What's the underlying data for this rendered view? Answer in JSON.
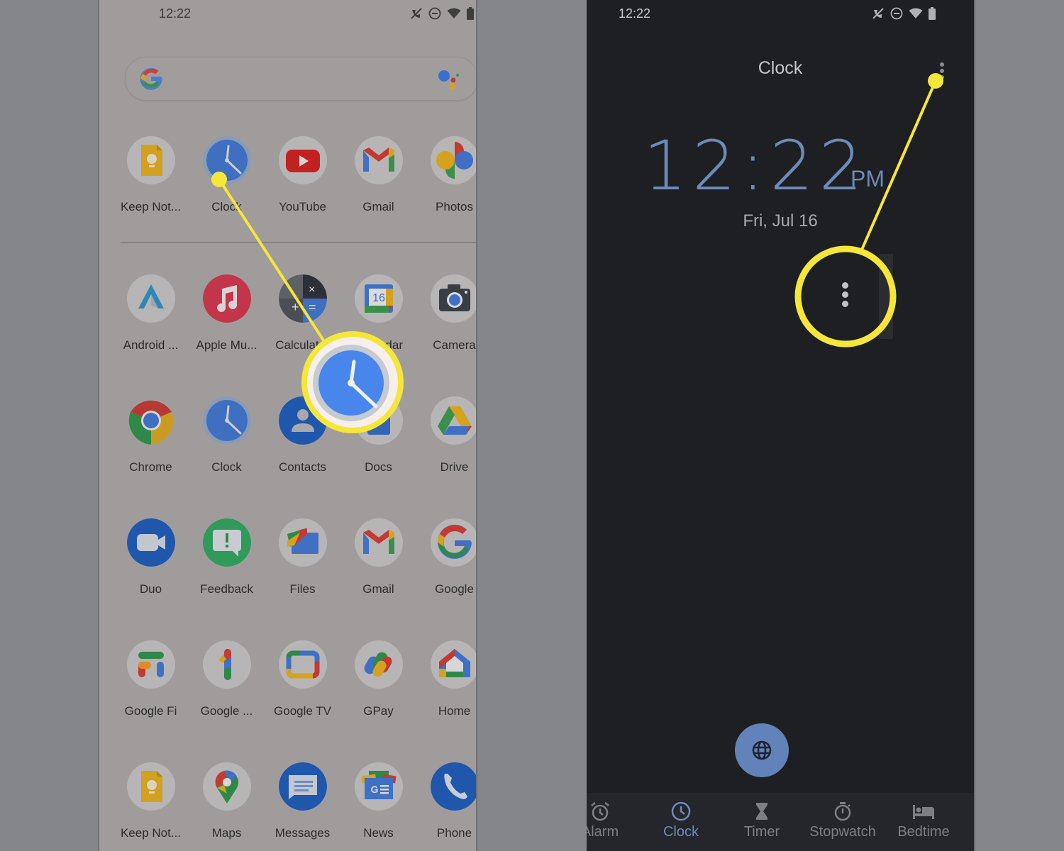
{
  "left_phone": {
    "status_bar": {
      "time": "12:22",
      "icons": [
        "call-muted-icon",
        "do-not-disturb-icon",
        "wifi-icon",
        "battery-icon"
      ]
    },
    "search_bar": {
      "logo": "google-g-logo",
      "assistant": "google-assistant-icon"
    },
    "favorites": [
      {
        "label": "Keep Not...",
        "icon": "keep-notes-icon"
      },
      {
        "label": "Clock",
        "icon": "clock-icon"
      },
      {
        "label": "YouTube",
        "icon": "youtube-icon"
      },
      {
        "label": "Gmail",
        "icon": "gmail-icon"
      },
      {
        "label": "Photos",
        "icon": "photos-icon"
      }
    ],
    "apps": [
      {
        "label": "Android ...",
        "icon": "android-auto-icon"
      },
      {
        "label": "Apple Mu...",
        "icon": "apple-music-icon"
      },
      {
        "label": "Calculator",
        "icon": "calculator-icon"
      },
      {
        "label": "Calendar",
        "icon": "calendar-icon",
        "badge": "16"
      },
      {
        "label": "Camera",
        "icon": "camera-icon"
      },
      {
        "label": "Chrome",
        "icon": "chrome-icon"
      },
      {
        "label": "Clock",
        "icon": "clock-icon"
      },
      {
        "label": "Contacts",
        "icon": "contacts-icon"
      },
      {
        "label": "Docs",
        "icon": "docs-icon"
      },
      {
        "label": "Drive",
        "icon": "drive-icon"
      },
      {
        "label": "Duo",
        "icon": "duo-icon"
      },
      {
        "label": "Feedback",
        "icon": "feedback-icon"
      },
      {
        "label": "Files",
        "icon": "files-icon"
      },
      {
        "label": "Gmail",
        "icon": "gmail-icon"
      },
      {
        "label": "Google",
        "icon": "google-icon"
      },
      {
        "label": "Google Fi",
        "icon": "google-fi-icon"
      },
      {
        "label": "Google ...",
        "icon": "google-one-icon"
      },
      {
        "label": "Google TV",
        "icon": "google-tv-icon"
      },
      {
        "label": "GPay",
        "icon": "gpay-icon"
      },
      {
        "label": "Home",
        "icon": "google-home-icon"
      },
      {
        "label": "Keep Not...",
        "icon": "keep-notes-icon"
      },
      {
        "label": "Maps",
        "icon": "maps-icon"
      },
      {
        "label": "Messages",
        "icon": "messages-icon"
      },
      {
        "label": "News",
        "icon": "news-icon"
      },
      {
        "label": "Phone",
        "icon": "phone-icon"
      }
    ]
  },
  "right_phone": {
    "status_bar": {
      "time": "12:22",
      "icons": [
        "call-muted-icon",
        "do-not-disturb-icon",
        "wifi-icon",
        "battery-icon"
      ]
    },
    "title": "Clock",
    "time": "12:22",
    "ampm": "PM",
    "date": "Fri, Jul 16",
    "fab_icon": "globe-icon",
    "bottom_nav": [
      {
        "label": "Alarm",
        "icon": "alarm-icon",
        "active": false
      },
      {
        "label": "Clock",
        "icon": "clock-icon",
        "active": true
      },
      {
        "label": "Timer",
        "icon": "hourglass-icon",
        "active": false
      },
      {
        "label": "Stopwatch",
        "icon": "stopwatch-icon",
        "active": false
      },
      {
        "label": "Bedtime",
        "icon": "bed-icon",
        "active": false
      }
    ]
  },
  "colors": {
    "highlight": "#f5e63a",
    "clock_accent": "#6d8bb9",
    "dark_bg": "#1d1f23",
    "launcher_bg": "#a19c9c"
  }
}
